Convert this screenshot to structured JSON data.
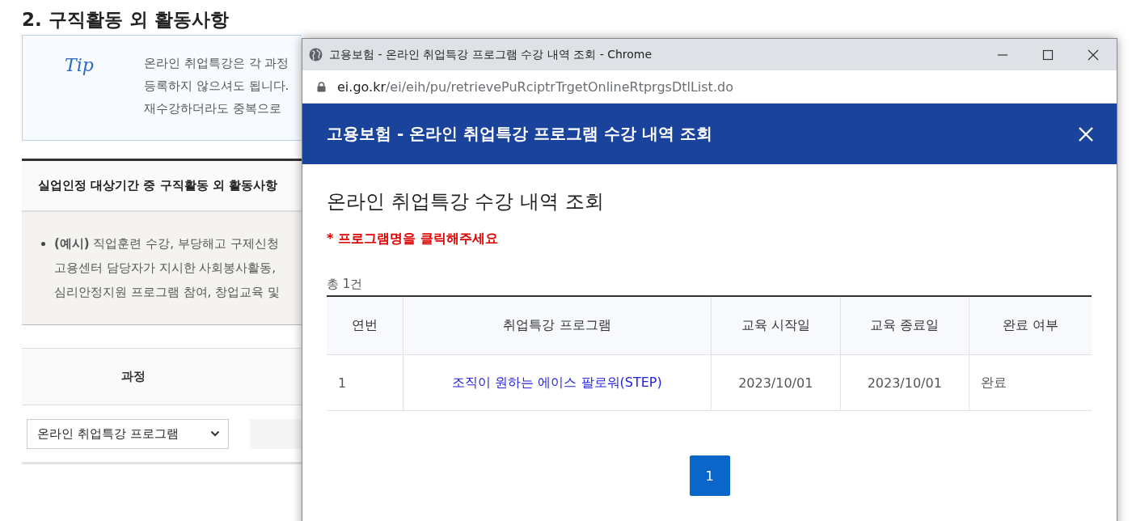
{
  "page": {
    "heading": "2. 구직활동 외 활동사항",
    "tip": {
      "label": "Tip",
      "lines": [
        "온라인 취업특강은 각 과정",
        "등록하지 않으셔도 됩니다.",
        "재수강하더라도 중복으로"
      ]
    },
    "section": {
      "title": "실업인정 대상기간 중 구직활동 외 활동사항",
      "example_lines": [
        "**(예시)** 직업훈련 수강, 부당해고 구제신청",
        "고용센터 담당자가 지시한 사회봉사활동,",
        "심리안정지원 프로그램 참여, 창업교육 및"
      ]
    },
    "table": {
      "columns": [
        "과정"
      ],
      "course_select": {
        "value": "온라인 취업특강 프로그램"
      }
    }
  },
  "popup": {
    "window_title": "고용보험 - 온라인 취업특강 프로그램 수강 내역 조회 - Chrome",
    "url_host": "ei.go.kr",
    "url_path": "/ei/eih/pu/retrievePuRciptrTrgetOnlineRtprgsDtlList.do",
    "header_title": "고용보험 - 온라인 취업특강 프로그램 수강 내역 조회",
    "title": "온라인 취업특강 수강 내역 조회",
    "notice": "* 프로그램명을 클릭해주세요",
    "total": "총 1건",
    "columns": [
      "연번",
      "취업특강 프로그램",
      "교육 시작일",
      "교육 종료일",
      "완료 여부"
    ],
    "rows": [
      {
        "cells": [
          "1",
          "조직이 원하는 에이스 팔로워(STEP)",
          "2023/10/01",
          "2023/10/01",
          "완료"
        ]
      }
    ],
    "pages": [
      {
        "label": "1",
        "selected": true
      }
    ]
  }
}
